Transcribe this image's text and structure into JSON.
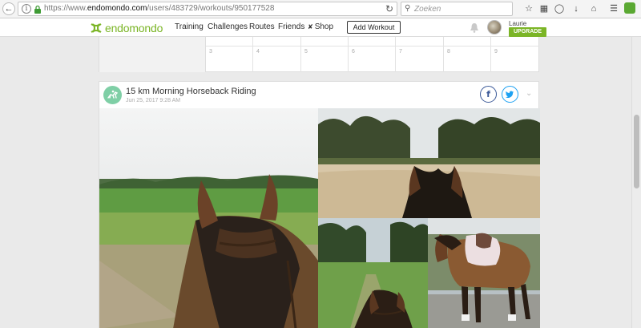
{
  "browser": {
    "url_prefix": "https://www.",
    "url_domain": "endomondo.com",
    "url_path": "/users/483729/workouts/950177528",
    "search_placeholder": "Zoeken",
    "icons": [
      "back-arrow-icon",
      "info-icon",
      "lock-icon",
      "reload-icon",
      "search-icon",
      "star-icon",
      "reading-list-icon",
      "pocket-icon",
      "download-icon",
      "home-icon",
      "menu-icon",
      "extension-icon"
    ]
  },
  "site_header": {
    "logo_text": "endomondo",
    "nav": {
      "training": "Training",
      "challenges": "Challenges",
      "routes": "Routes",
      "friends": "Friends",
      "shop": "Shop"
    },
    "add_workout": "Add Workout",
    "user_name": "Laurie",
    "upgrade": "UPGRADE",
    "brand_color": "#7bb526"
  },
  "calendar": {
    "days": [
      "3",
      "4",
      "5",
      "6",
      "7",
      "8",
      "9"
    ]
  },
  "workout": {
    "title": "15 km Morning Horseback Riding",
    "date": "Jun 25, 2017 9:28 AM",
    "share_facebook": "f",
    "share_twitter": "t",
    "sport_icon": "horse-riding-icon",
    "accent_color": "#7fcfa6"
  },
  "photos": [
    "photo-field-ride",
    "photo-sand-arena",
    "photo-forest-path",
    "photo-saddled-horse"
  ]
}
